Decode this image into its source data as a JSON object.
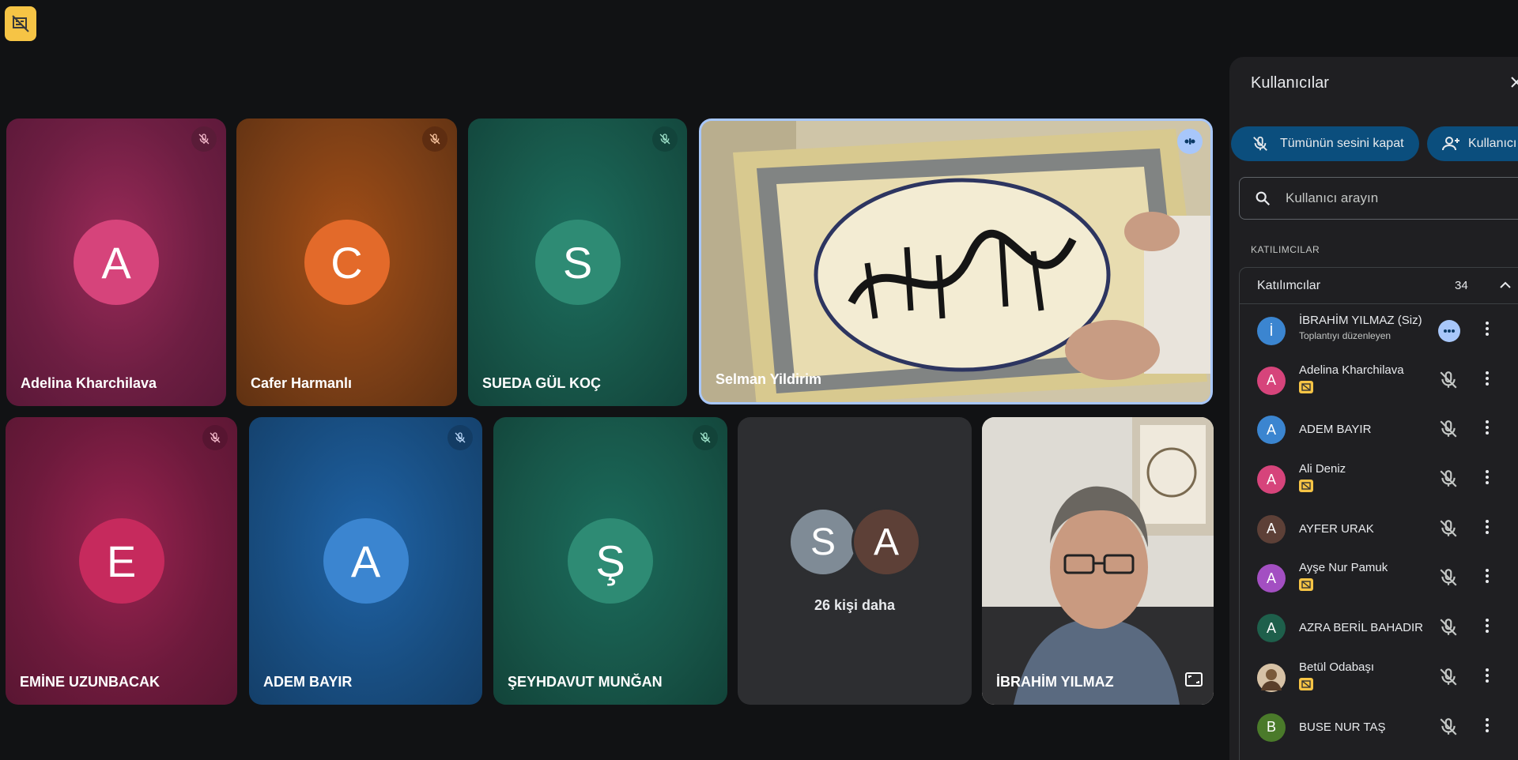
{
  "colors": {
    "accent": "#a8c7fa",
    "panel_button": "#0b4e7d",
    "badge_yellow": "#f6c445"
  },
  "tiles": [
    {
      "name": "Adelina Kharchilava",
      "initial": "A",
      "avatar_color": "#d6447b",
      "muted": true
    },
    {
      "name": "Cafer Harmanlı",
      "initial": "C",
      "avatar_color": "#e36a2a",
      "muted": true
    },
    {
      "name": "SUEDA GÜL KOÇ",
      "initial": "S",
      "avatar_color": "#2e8b74",
      "muted": true
    },
    {
      "name": "Selman Yildirim",
      "speaking": true
    },
    {
      "name": "EMİNE UZUNBACAK",
      "initial": "E",
      "avatar_color": "#c62a5d",
      "muted": true
    },
    {
      "name": "ADEM BAYIR",
      "initial": "A",
      "avatar_color": "#3b85d0",
      "muted": true
    },
    {
      "name": "ŞEYHDAVUT MUNĞAN",
      "initial": "Ş",
      "avatar_color": "#2e8b74",
      "muted": true
    },
    {
      "name": "İBRAHİM YILMAZ"
    }
  ],
  "more_tile": {
    "avatar1": "S",
    "avatar2": "A",
    "label": "26 kişi daha"
  },
  "panel": {
    "title": "Kullanıcılar",
    "mute_all_label": "Tümünün sesini kapat",
    "add_label": "Kullanıcı",
    "search_placeholder": "Kullanıcı arayın",
    "section_label": "KATILIMCILAR",
    "group_label": "Katılımcılar",
    "group_count": "34",
    "participants": [
      {
        "initial": "İ",
        "name": "İBRAHİM YILMAZ (Siz)",
        "sub": "Toplantıyı düzenleyen",
        "color": "#3b85d0",
        "host": true
      },
      {
        "initial": "A",
        "name": "Adelina Kharchilava",
        "color": "#d6447b",
        "badge": true
      },
      {
        "initial": "A",
        "name": "ADEM BAYIR",
        "color": "#3b85d0"
      },
      {
        "initial": "A",
        "name": "Ali Deniz",
        "color": "#d6447b",
        "badge": true
      },
      {
        "initial": "A",
        "name": "AYFER URAK",
        "color": "#5d4037"
      },
      {
        "initial": "A",
        "name": "Ayşe Nur Pamuk",
        "color": "#a34fc2",
        "badge": true
      },
      {
        "initial": "A",
        "name": "AZRA BERİL BAHADIR",
        "color": "#1e5f4b"
      },
      {
        "initial": "",
        "name": "Betül Odabaşı",
        "color": "#8a6a4a",
        "badge": true,
        "photo": true
      },
      {
        "initial": "B",
        "name": "BUSE NUR TAŞ",
        "color": "#4a7a2a"
      }
    ]
  }
}
